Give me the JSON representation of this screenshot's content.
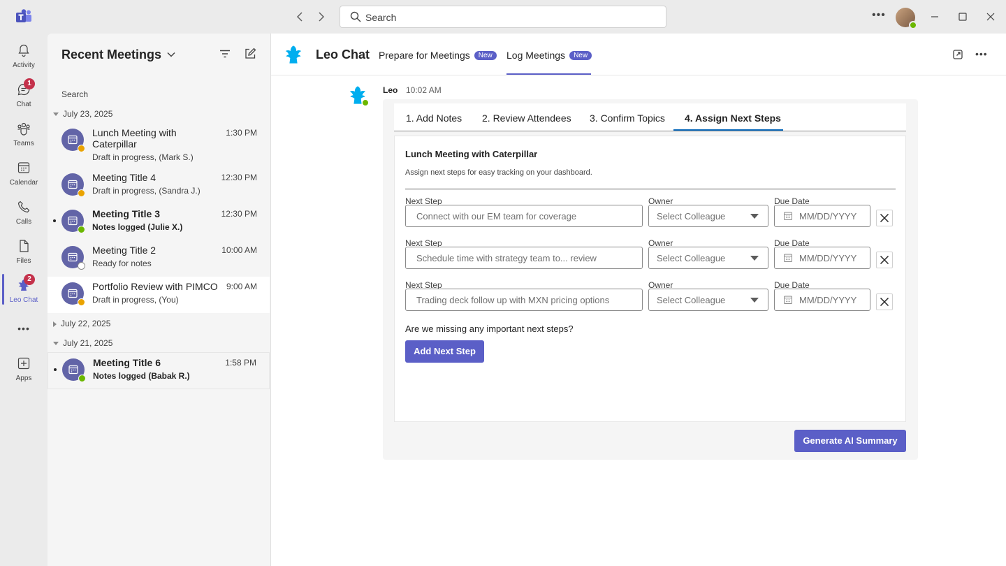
{
  "titlebar": {
    "search_placeholder": "Search",
    "more_label": "•••"
  },
  "rail": {
    "items": [
      {
        "label": "Activity",
        "icon": "bell-icon"
      },
      {
        "label": "Chat",
        "icon": "chat-icon",
        "badge": "1"
      },
      {
        "label": "Teams",
        "icon": "teams-icon"
      },
      {
        "label": "Calendar",
        "icon": "calendar-icon"
      },
      {
        "label": "Calls",
        "icon": "phone-icon"
      },
      {
        "label": "Files",
        "icon": "file-icon"
      },
      {
        "label": "Leo Chat",
        "icon": "leo-icon",
        "badge": "2",
        "active": true
      },
      {
        "label": "",
        "icon": "more-icon"
      },
      {
        "label": "Apps",
        "icon": "apps-icon"
      }
    ],
    "more_label": "•••"
  },
  "left_pane": {
    "title": "Recent Meetings",
    "search_label": "Search",
    "groups": [
      {
        "date": "July 23, 2025",
        "expanded": true
      },
      {
        "date": "July 22, 2025",
        "expanded": false
      },
      {
        "date": "July 21, 2025",
        "expanded": true
      }
    ],
    "meetings": [
      {
        "title": "Lunch Meeting with Caterpillar",
        "subtitle": "Draft in progress, (Mark S.)",
        "time": "1:30 PM",
        "status": "pending"
      },
      {
        "title": "Meeting Title 4",
        "subtitle": "Draft in progress, (Sandra J.)",
        "time": "12:30 PM",
        "status": "pending"
      },
      {
        "title": "Meeting Title 3",
        "subtitle": "Notes logged (Julie X.)",
        "time": "12:30 PM",
        "status": "done",
        "unread": true
      },
      {
        "title": "Meeting Title 2",
        "subtitle": "Ready for notes",
        "time": "10:00 AM",
        "status": "ready"
      },
      {
        "title": "Portfolio Review with PIMCO",
        "subtitle": "Draft in progress, (You)",
        "time": "9:00 AM",
        "status": "pending",
        "selected": true
      },
      {
        "title": "Meeting Title 6",
        "subtitle": "Notes logged (Babak R.)",
        "time": "1:58 PM",
        "status": "done",
        "unread": true
      }
    ]
  },
  "main": {
    "app_name": "Leo Chat",
    "tabs": [
      {
        "label": "Prepare for Meetings",
        "badge": "New"
      },
      {
        "label": "Log Meetings",
        "badge": "New",
        "active": true
      }
    ],
    "more_label": "•••",
    "message": {
      "sender": "Leo",
      "time": "10:02 AM"
    },
    "steps": [
      "1.  Add Notes",
      "2.  Review Attendees",
      "3.  Confirm Topics",
      "4.  Assign Next Steps"
    ],
    "active_step": 4,
    "card": {
      "title": "Lunch Meeting with Caterpillar",
      "description": "Assign next steps for easy tracking on your dashboard.",
      "labels": {
        "next_step": "Next Step",
        "owner": "Owner",
        "due_date": "Due Date"
      },
      "rows": [
        {
          "next_step_placeholder": "Connect with our EM team for coverage",
          "owner_placeholder": "Select Colleague",
          "date_placeholder": "MM/DD/YYYY"
        },
        {
          "next_step_placeholder": "Schedule time with strategy team to... review",
          "owner_placeholder": "Select Colleague",
          "date_placeholder": "MM/DD/YYYY"
        },
        {
          "next_step_placeholder": "Trading deck follow up with MXN pricing options",
          "owner_placeholder": "Select Colleague",
          "date_placeholder": "MM/DD/YYYY"
        }
      ],
      "missing_prompt": "Are we missing any important next steps?",
      "add_button": "Add Next Step"
    },
    "generate_button": "Generate AI Summary"
  },
  "colors": {
    "brand": "#5b5fc7",
    "leo_blue": "#00aeef",
    "status_pending": "#eaa300",
    "status_done": "#6bb700"
  }
}
